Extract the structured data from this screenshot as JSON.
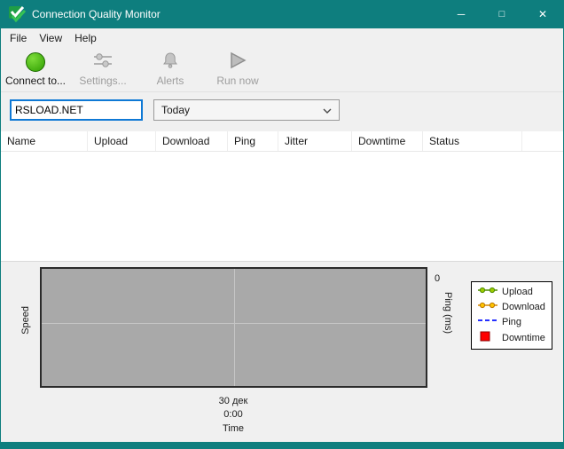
{
  "colors": {
    "titlebar": "#0e7e7e",
    "focus_border": "#0f79d5",
    "plot_background": "#a9a9a9"
  },
  "window": {
    "title": "Connection Quality Monitor",
    "controls": {
      "minimize": "─",
      "maximize": "□",
      "close": "✕"
    }
  },
  "menu": {
    "items": [
      {
        "label": "File"
      },
      {
        "label": "View"
      },
      {
        "label": "Help"
      }
    ]
  },
  "toolbar": {
    "buttons": [
      {
        "label": "Connect to...",
        "icon": "connect-circle-icon",
        "enabled": true
      },
      {
        "label": "Settings...",
        "icon": "sliders-icon",
        "enabled": false
      },
      {
        "label": "Alerts",
        "icon": "bell-icon",
        "enabled": false
      },
      {
        "label": "Run now",
        "icon": "play-icon",
        "enabled": false
      }
    ]
  },
  "filters": {
    "host_value": "RSLOAD.NET",
    "period_value": "Today"
  },
  "table": {
    "columns": [
      "Name",
      "Upload",
      "Download",
      "Ping",
      "Jitter",
      "Downtime",
      "Status"
    ],
    "rows": []
  },
  "chart_data": {
    "type": "line",
    "title": "",
    "xlabel": "Time",
    "ylabel_left": "Speed",
    "ylabel_right": "Ping (ms)",
    "x_tick_labels": [
      "30 дек",
      "0:00"
    ],
    "right_axis_ticks": [
      "0"
    ],
    "grid": true,
    "legend_position": "right",
    "series": [
      {
        "name": "Upload",
        "color": "#76b900",
        "marker": "line-circles",
        "values": []
      },
      {
        "name": "Download",
        "color": "#ffa200",
        "marker": "line-circles",
        "values": []
      },
      {
        "name": "Ping",
        "color": "#2630ff",
        "marker": "dashed-line",
        "values": []
      },
      {
        "name": "Downtime",
        "color": "#ff0000",
        "marker": "square",
        "values": []
      }
    ]
  }
}
